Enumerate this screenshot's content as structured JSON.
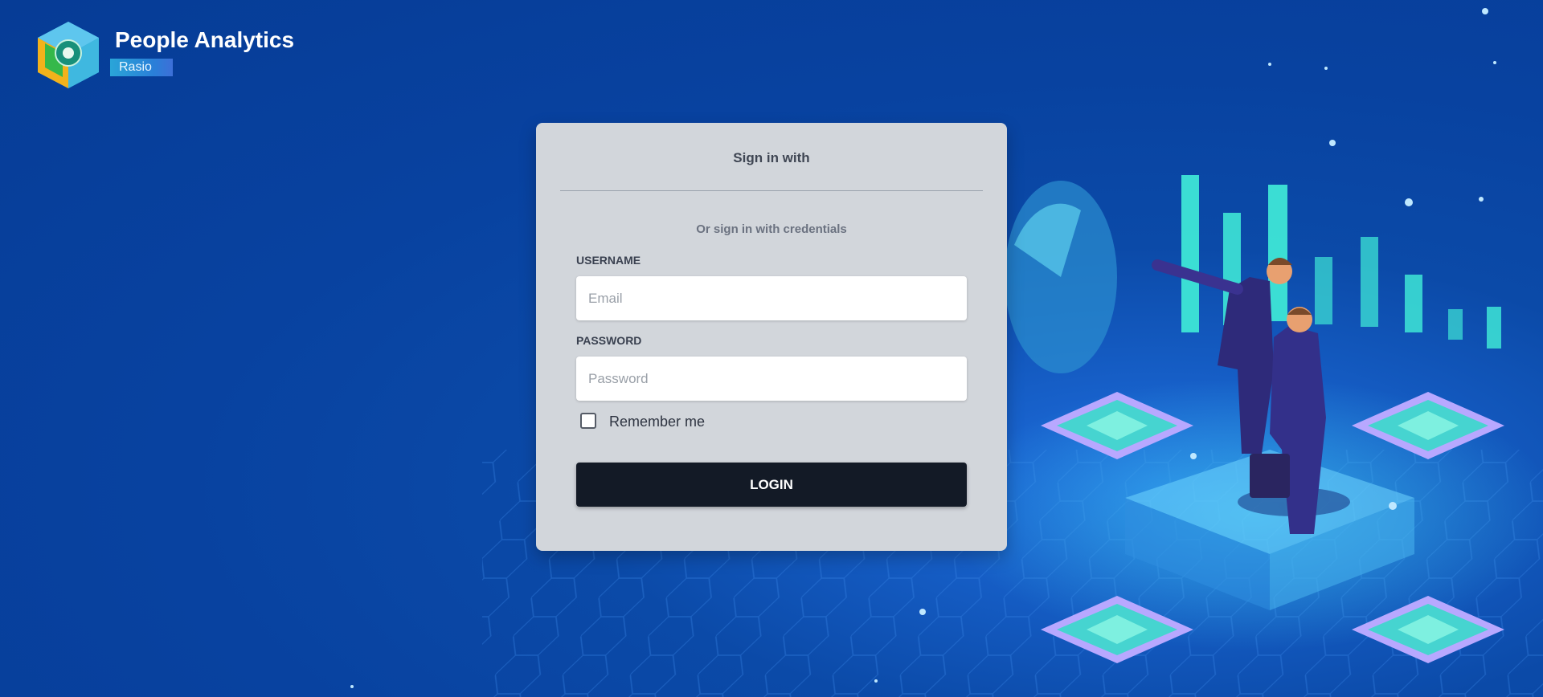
{
  "brand": {
    "title": "People Analytics",
    "badge": "Rasio",
    "logo_icon": "hexagon-cube-logo-icon"
  },
  "login_card": {
    "heading": "Sign in with",
    "subheading": "Or sign in with credentials",
    "username_label": "USERNAME",
    "username_placeholder": "Email",
    "username_value": "",
    "password_label": "PASSWORD",
    "password_placeholder": "Password",
    "password_value": "",
    "remember_label": "Remember me",
    "remember_checked": false,
    "login_label": "LOGIN"
  },
  "illustration": {
    "icon": "business-analytics-illustration",
    "description_icons": [
      "bar-chart-icon",
      "pie-chart-icon",
      "businessmen-icon",
      "isometric-chip-icon"
    ]
  },
  "colors": {
    "background": "#0842a0",
    "card": "#d2d6db",
    "button": "#131a26",
    "accent_teal": "#3ee6d6",
    "badge": "#2a9fd8"
  }
}
